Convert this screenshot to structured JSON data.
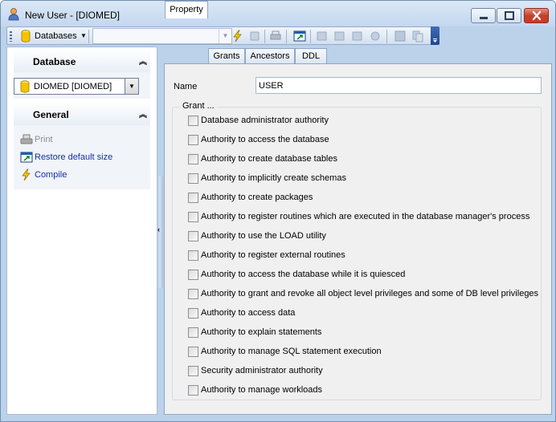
{
  "window": {
    "title": "New User - [DIOMED]"
  },
  "toolbar": {
    "databases_label": "Databases",
    "combo_value": ""
  },
  "sidebar": {
    "database_header": "Database",
    "database_value": "DIOMED [DIOMED]",
    "general_header": "General",
    "links": [
      {
        "label": "Print",
        "icon": "printer-icon",
        "enabled": false
      },
      {
        "label": "Restore default size",
        "icon": "restore-size-icon",
        "enabled": true
      },
      {
        "label": "Compile",
        "icon": "lightning-icon",
        "enabled": true
      }
    ]
  },
  "tabs": [
    {
      "label": "Property",
      "active": true
    },
    {
      "label": "Grants",
      "active": false
    },
    {
      "label": "Ancestors",
      "active": false
    },
    {
      "label": "DDL",
      "active": false
    }
  ],
  "property": {
    "name_label": "Name",
    "name_value": "USER",
    "grant_legend": "Grant ...",
    "authorities": [
      "Database administrator authority",
      "Authority to access the database",
      "Authority to create database tables",
      "Authority to implicitly create schemas",
      "Authority to create packages",
      "Authority to register routines which are executed in the database manager's process",
      "Authority to use the LOAD utility",
      "Authority to register external routines",
      "Authority to access the database while it is quiesced",
      "Authority to grant and revoke all object level privileges and some of DB level privileges",
      "Authority to access data",
      "Authority to explain statements",
      "Authority to manage SQL statement execution",
      "Security administrator authority",
      "Authority to manage workloads"
    ]
  },
  "colors": {
    "accent": "#1630a6",
    "frame": "#bcd2ea",
    "close": "#c93b23"
  }
}
